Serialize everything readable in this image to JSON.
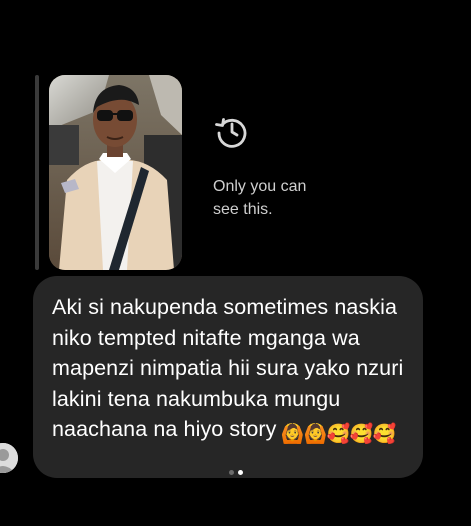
{
  "story_reply": {
    "thumbnail_alt": "story-photo-man-in-car",
    "expired_icon": "history-icon",
    "visibility_note": "Only you can\nsee this."
  },
  "message": {
    "text": "Aki si nakupenda sometimes naskia niko tempted nitafte mganga wa mapenzi nimpatia hii sura yako nzuri lakini tena nakumbuka mungu naachana na hiyo story",
    "emojis": [
      "🙆",
      "🙆",
      "🥰",
      "🥰",
      "🥰"
    ],
    "sender_avatar": "avatar-placeholder-icon"
  },
  "pager": {
    "dots": 2,
    "active_index": 1
  },
  "colors": {
    "background": "#000000",
    "bubble": "#262626",
    "secondary_text": "#cfcfcf",
    "reply_bar": "#3a3a3a"
  }
}
